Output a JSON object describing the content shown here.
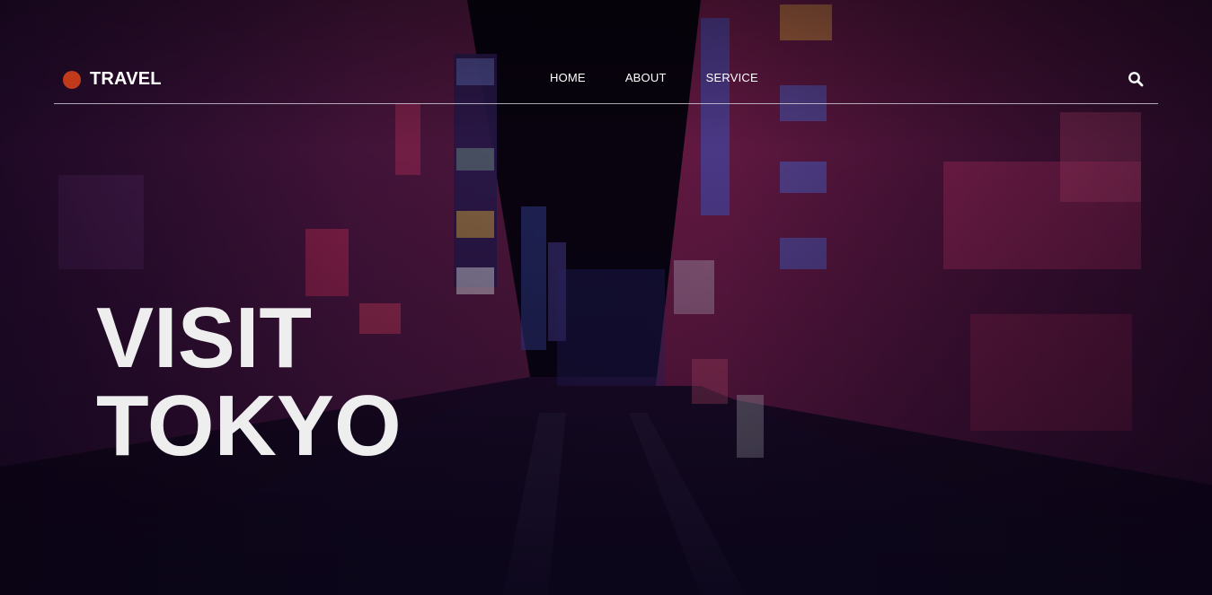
{
  "header": {
    "logo_text": "TRAVEL",
    "logo_dot_color": "#c13a1c"
  },
  "nav": {
    "items": [
      {
        "label": "HOME"
      },
      {
        "label": "ABOUT"
      },
      {
        "label": "SERVICE"
      }
    ]
  },
  "search": {
    "icon": "search-icon"
  },
  "hero": {
    "line1": "VISIT",
    "line2": "TOKYO"
  },
  "colors": {
    "text": "#ffffff",
    "headline": "#eeeeef",
    "accent": "#c13a1c",
    "background": "#1d0a22"
  }
}
